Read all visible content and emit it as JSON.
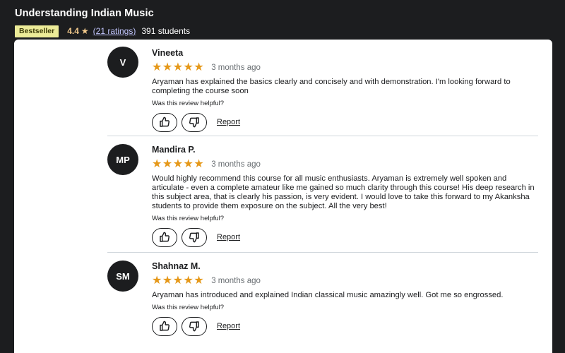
{
  "course": {
    "title": "Understanding Indian Music",
    "badge": "Bestseller",
    "rating": "4.4",
    "ratings_count": "(21 ratings)",
    "students": "391 students"
  },
  "helpful_prompt": "Was this review helpful?",
  "report_label": "Report",
  "icons": [
    "star-icon",
    "thumbs-up-icon",
    "thumbs-down-icon"
  ],
  "colors": {
    "header_bg": "#1c1d1f",
    "badge_bg": "#eceb98",
    "star": "#e59819",
    "rating_text": "#f3ca8c",
    "link": "#c0c4fc"
  },
  "reviews": [
    {
      "initials": "V",
      "name": "Vineeta",
      "rating": 5,
      "stars_glyph": "★★★★★",
      "when": "3 months ago",
      "text": "Aryaman has explained the basics clearly and concisely and with demonstration. I'm looking forward to completing the course soon"
    },
    {
      "initials": "MP",
      "name": "Mandira P.",
      "rating": 5,
      "stars_glyph": "★★★★★",
      "when": "3 months ago",
      "text": "Would highly recommend this course for all music enthusiasts. Aryaman is extremely well spoken and articulate - even a complete amateur like me gained so much clarity through this course! His deep research in this subject area, that is clearly his passion, is very evident. I would love to take this forward to my Akanksha students to provide them exposure on the subject. All the very best!"
    },
    {
      "initials": "SM",
      "name": "Shahnaz M.",
      "rating": 5,
      "stars_glyph": "★★★★★",
      "when": "3 months ago",
      "text": "Aryaman has introduced and explained Indian classical music amazingly well. Got me so engrossed."
    }
  ]
}
